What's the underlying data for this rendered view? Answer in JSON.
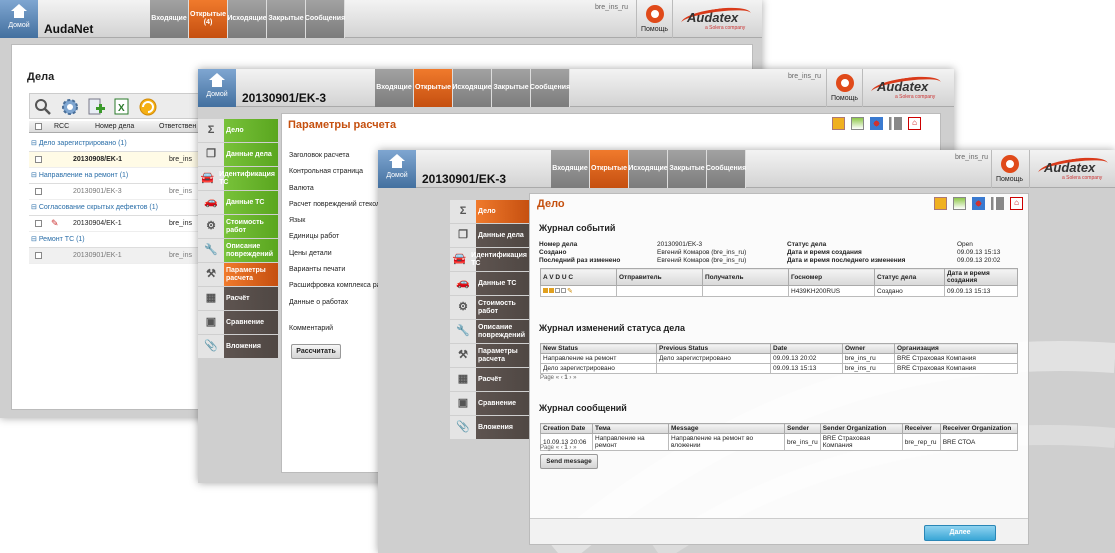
{
  "w1": {
    "home": "Домой",
    "title": "AudaNet",
    "tabs": [
      "Входящие",
      "Открытые (4)",
      "Исходящие",
      "Закрытые",
      "Сообщения"
    ],
    "user": "bre_ins_ru",
    "help": "Помощь",
    "logo": "Audatex",
    "logo_sub": "a Solera company",
    "heading": "Дела",
    "cols": [
      "RCC",
      "Номер дела",
      "Ответствен"
    ],
    "groups": [
      {
        "label": "Дело зарегистрировано (1)",
        "rows": [
          {
            "num": "20130908/EK-1",
            "owner": "bre_ins"
          }
        ]
      },
      {
        "label": "Направление на ремонт (1)",
        "rows": [
          {
            "num": "20130901/EK-3",
            "owner": "bre_ins"
          }
        ]
      },
      {
        "label": "Согласование скрытых дефектов (1)",
        "rows": [
          {
            "num": "20130904/EK-1",
            "owner": "bre_ins"
          }
        ]
      },
      {
        "label": "Ремонт ТС (1)",
        "rows": [
          {
            "num": "20130901/EK-1",
            "owner": "bre_ins"
          }
        ]
      }
    ]
  },
  "w2": {
    "home": "Домой",
    "title": "20130901/EK-3",
    "tabs": [
      "Входящие",
      "Открытые",
      "Исходящие",
      "Закрытые",
      "Сообщения"
    ],
    "user": "bre_ins_ru",
    "help": "Помощь",
    "logo": "Audatex",
    "logo_sub": "a Solera company",
    "nav": [
      "Дело",
      "Данные дела",
      "Идентификация ТС",
      "Данные ТС",
      "Стоимость работ",
      "Описание повреждений",
      "Параметры расчета",
      "Расчёт",
      "Сравнение",
      "Вложения"
    ],
    "heading": "Параметры расчета",
    "fields": [
      "Заголовок расчета",
      "Контрольная страница",
      "Валюта",
      "Расчет повреждений стекол",
      "Язык",
      "Единицы работ",
      "Цены детали",
      "Варианты печати",
      "Расшифровка комплекса раб",
      "Данные о работах",
      "Комментарий"
    ],
    "calc": "Рассчитать"
  },
  "w3": {
    "home": "Домой",
    "title": "20130901/EK-3",
    "tabs": [
      "Входящие",
      "Открытые",
      "Исходящие",
      "Закрытые",
      "Сообщения"
    ],
    "user": "bre_ins_ru",
    "help": "Помощь",
    "logo": "Audatex",
    "logo_sub": "a Solera company",
    "nav": [
      "Дело",
      "Данные дела",
      "Идентификация ТС",
      "Данные ТС",
      "Стоимость работ",
      "Описание повреждений",
      "Параметры расчета",
      "Расчёт",
      "Сравнение",
      "Вложения"
    ],
    "heading": "Дело",
    "events_title": "Журнал событий",
    "info": {
      "l1": "Номер дела",
      "v1": "20130901/EK-3",
      "l2": "Статус дела",
      "v2": "Open",
      "l3": "Создано",
      "v3": "Евгений Комаров (bre_ins_ru)",
      "l4": "Дата и время создания",
      "v4": "09.09.13 15:13",
      "l5": "Последний раз изменено",
      "v5": "Евгений Комаров (bre_ins_ru)",
      "l6": "Дата и время последнего изменения",
      "v6": "09.09.13 20:02"
    },
    "ev_cols": [
      "A V D U C",
      "Отправитель",
      "Получатель",
      "Госномер",
      "Статус дела",
      "Дата и время создания"
    ],
    "ev_row": {
      "plate": "H439KH200RUS",
      "status": "Создано",
      "date": "09.09.13 15:13"
    },
    "status_title": "Журнал изменений статуса дела",
    "st_cols": [
      "New Status",
      "Previous Status",
      "Date",
      "Owner",
      "Организация"
    ],
    "st_rows": [
      [
        "Направление на ремонт",
        "Дело зарегистрировано",
        "09.09.13 20:02",
        "bre_ins_ru",
        "BRE Страховая Компания"
      ],
      [
        "Дело зарегистрировано",
        "",
        "09.09.13 15:13",
        "bre_ins_ru",
        "BRE Страховая Компания"
      ]
    ],
    "page_label": "Page",
    "page_num": "1",
    "msg_title": "Журнал сообщений",
    "msg_cols": [
      "Creation Date",
      "Тема",
      "Message",
      "Sender",
      "Sender Organization",
      "Receiver",
      "Receiver Organization"
    ],
    "msg_row": [
      "10.09.13 20:06",
      "Направление на ремонт",
      "Направление на ремонт во вложении",
      "bre_ins_ru",
      "BRE Страховая Компания",
      "bre_rep_ru",
      "BRE СТОА"
    ],
    "send": "Send message",
    "next": "Далее"
  }
}
